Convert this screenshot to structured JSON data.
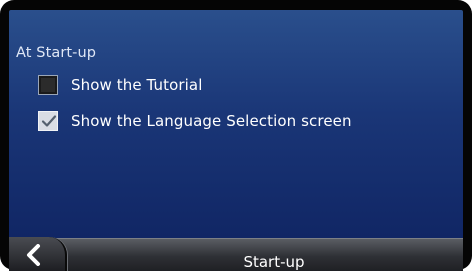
{
  "settings": {
    "section_heading": "At Start-up",
    "options": [
      {
        "label": "Show the Tutorial",
        "checked": false
      },
      {
        "label": "Show the Language Selection screen",
        "checked": true
      }
    ]
  },
  "bottom_bar": {
    "title": "Start-up",
    "back_icon": "back-arrow-icon"
  },
  "colors": {
    "screen_top": "#2a4f8c",
    "screen_bottom": "#0e2260",
    "text": "#ffffff"
  }
}
